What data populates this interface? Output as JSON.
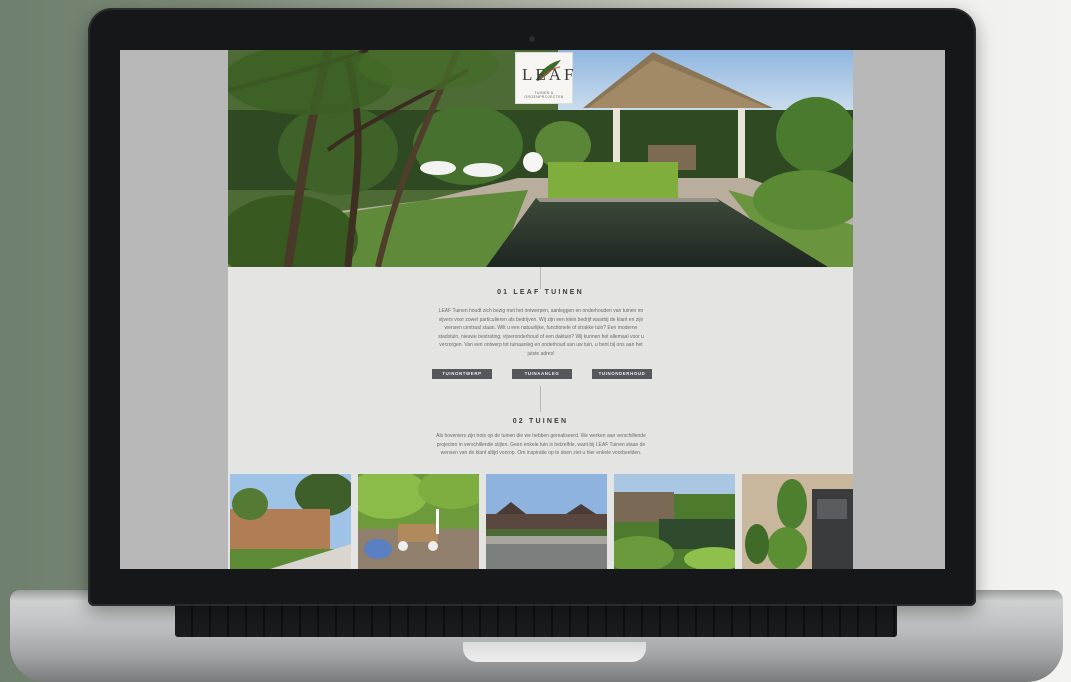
{
  "logo": {
    "text": "LEAF",
    "subtitle": "TUINEN & GROENPROJECTEN"
  },
  "section1": {
    "title": "01 LEAF TUINEN",
    "lines": [
      "LEAF Tuinen houdt zich bezig met het ontwerpen, aanleggen en onderhouden van tuinen en",
      "vijvers voor zowel particulieren als bedrijven. Wij zijn een klein bedrijf waarbij de klant en zijn",
      "wensen centraal staan. Wilt u een natuurlijke, functionele of strakke tuin? Een moderne",
      "stadstuin, nieuwe bestrating, vijveronderhoud of een daktuin? Wij kunnen het allemaal voor u",
      "verzorgen. Van een ontwerp tot tuinaanleg en onderhoud van uw tuin, u bent bij ons aan het",
      "juiste adres!"
    ],
    "buttons": [
      "TUINONTWERP",
      "TUINAANLEG",
      "TUINONDERHOUD"
    ]
  },
  "section2": {
    "title": "02 TUINEN",
    "lines": [
      "Als hoveniers zijn trots op de tuinen die we hebben gerealiseerd. We werken aan verschillende",
      "projecten in verschillende stijlen. Geen enkele tuin is hetzelfde, want bij LEAF Tuinen staan de",
      "wensen van de klant altijd voorop. Om inspiratie op te doen ziet u hier enkele voorbeelden."
    ]
  },
  "colors": {
    "accent": "#54575b",
    "page_bg": "#e4e4e3",
    "hero_green": "#3f5e2a"
  },
  "icons": [
    "leaf-logo-icon"
  ]
}
